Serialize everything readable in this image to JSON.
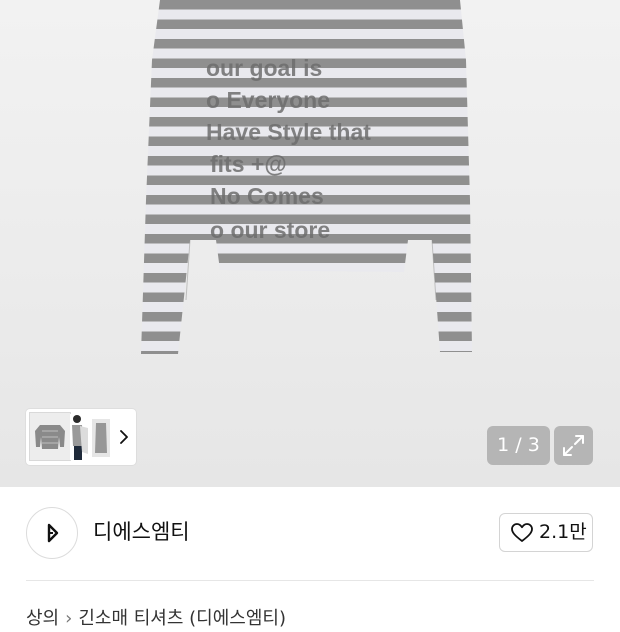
{
  "product_image": {
    "print_lines": [
      "our goal is",
      "o Everyone",
      "Have Style that",
      "fits +@",
      "No Comes",
      "o our store"
    ]
  },
  "gallery": {
    "counter": "1 / 3",
    "thumbnail_next_icon": "chevron-right-icon",
    "expand_icon": "expand-icon"
  },
  "seller": {
    "name": "디에스엠티",
    "avatar_icon": "brand-logo-icon",
    "like_icon": "heart-outline-icon",
    "like_count": "2.1만"
  },
  "breadcrumb": {
    "items": [
      "상의",
      "긴소매 티셔츠 (디에스엠티)"
    ],
    "separator": "›"
  },
  "colors": {
    "stripe_gray": "#8f8f8f",
    "stripe_white": "#e9e9ee",
    "overlay_gray": "#969696",
    "text": "#111111"
  }
}
